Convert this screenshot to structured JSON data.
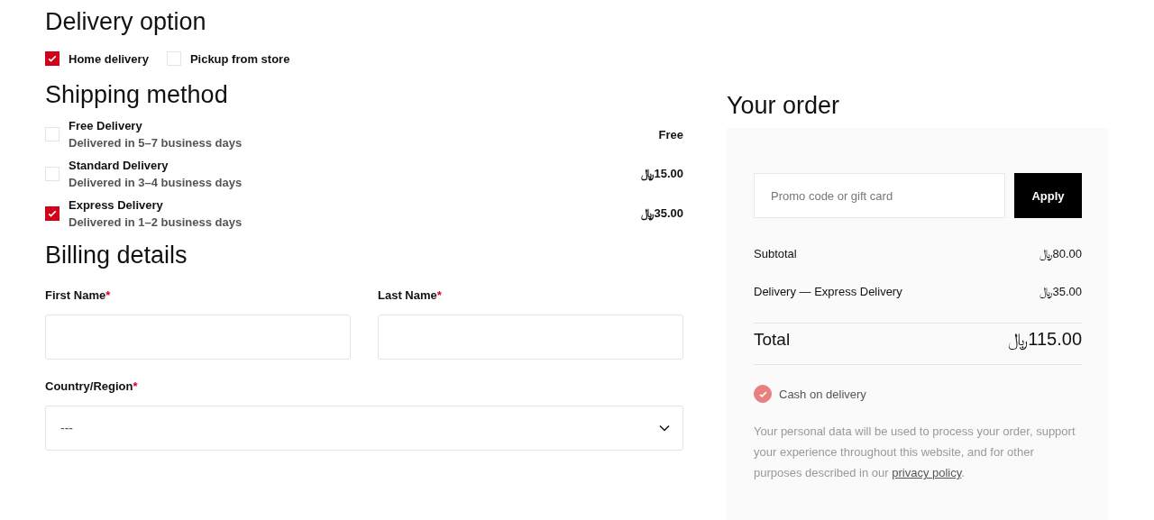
{
  "delivery_option": {
    "title": "Delivery option",
    "options": [
      {
        "label": "Home delivery",
        "checked": true
      },
      {
        "label": "Pickup from store",
        "checked": false
      }
    ]
  },
  "shipping_method": {
    "title": "Shipping method",
    "methods": [
      {
        "name": "Free Delivery",
        "detail": "Delivered in 5–7 business days",
        "price": "Free",
        "selected": false
      },
      {
        "name": "Standard Delivery",
        "detail": "Delivered in 3–4 business days",
        "price": "﷼15.00",
        "selected": false
      },
      {
        "name": "Express Delivery",
        "detail": "Delivered in 1–2 business days",
        "price": "﷼35.00",
        "selected": true
      }
    ]
  },
  "billing": {
    "title": "Billing details",
    "fields": [
      {
        "label": "First Name",
        "required_mark": "*",
        "kind": "text"
      },
      {
        "label": "Last Name",
        "required_mark": "*",
        "kind": "text"
      },
      {
        "label": "Country/Region",
        "required_mark": "*",
        "kind": "select",
        "value": "---"
      }
    ]
  },
  "order": {
    "title": "Your order",
    "promo": {
      "placeholder": "Promo code or gift card",
      "button": "Apply"
    },
    "lines": [
      {
        "label": "Subtotal",
        "amount": "﷼80.00"
      },
      {
        "label": "Delivery — Express Delivery",
        "amount": "﷼35.00"
      }
    ],
    "total": {
      "label": "Total",
      "amount": "﷼115.00"
    },
    "payment": {
      "label": "Cash on delivery",
      "checked": true
    },
    "privacy": {
      "text": "Your personal data will be used to process your order, support your experience throughout this website, and for other purposes described in our ",
      "link": "privacy policy",
      "after": "."
    }
  }
}
